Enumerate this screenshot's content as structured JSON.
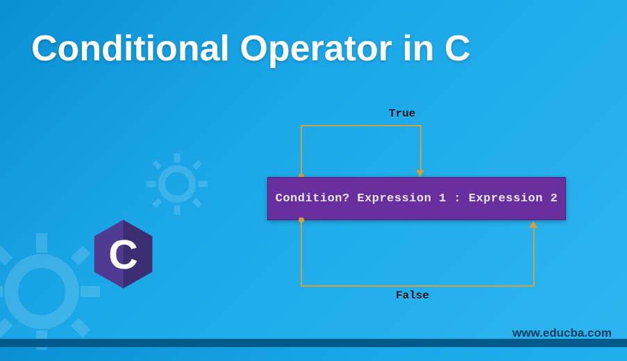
{
  "title": "Conditional Operator in C",
  "diagram": {
    "syntax": "Condition? Expression 1 : Expression 2",
    "true_label": "True",
    "false_label": "False"
  },
  "watermark": "www.educba.com",
  "logo": {
    "letter": "C",
    "bg_color": "#4f3b91",
    "letter_color": "#ffffff"
  },
  "colors": {
    "syntax_box_bg": "#6a2f9e",
    "syntax_text": "#e8e8f0",
    "flow_line": "#d4a03e",
    "label": "#0d0d1a"
  }
}
